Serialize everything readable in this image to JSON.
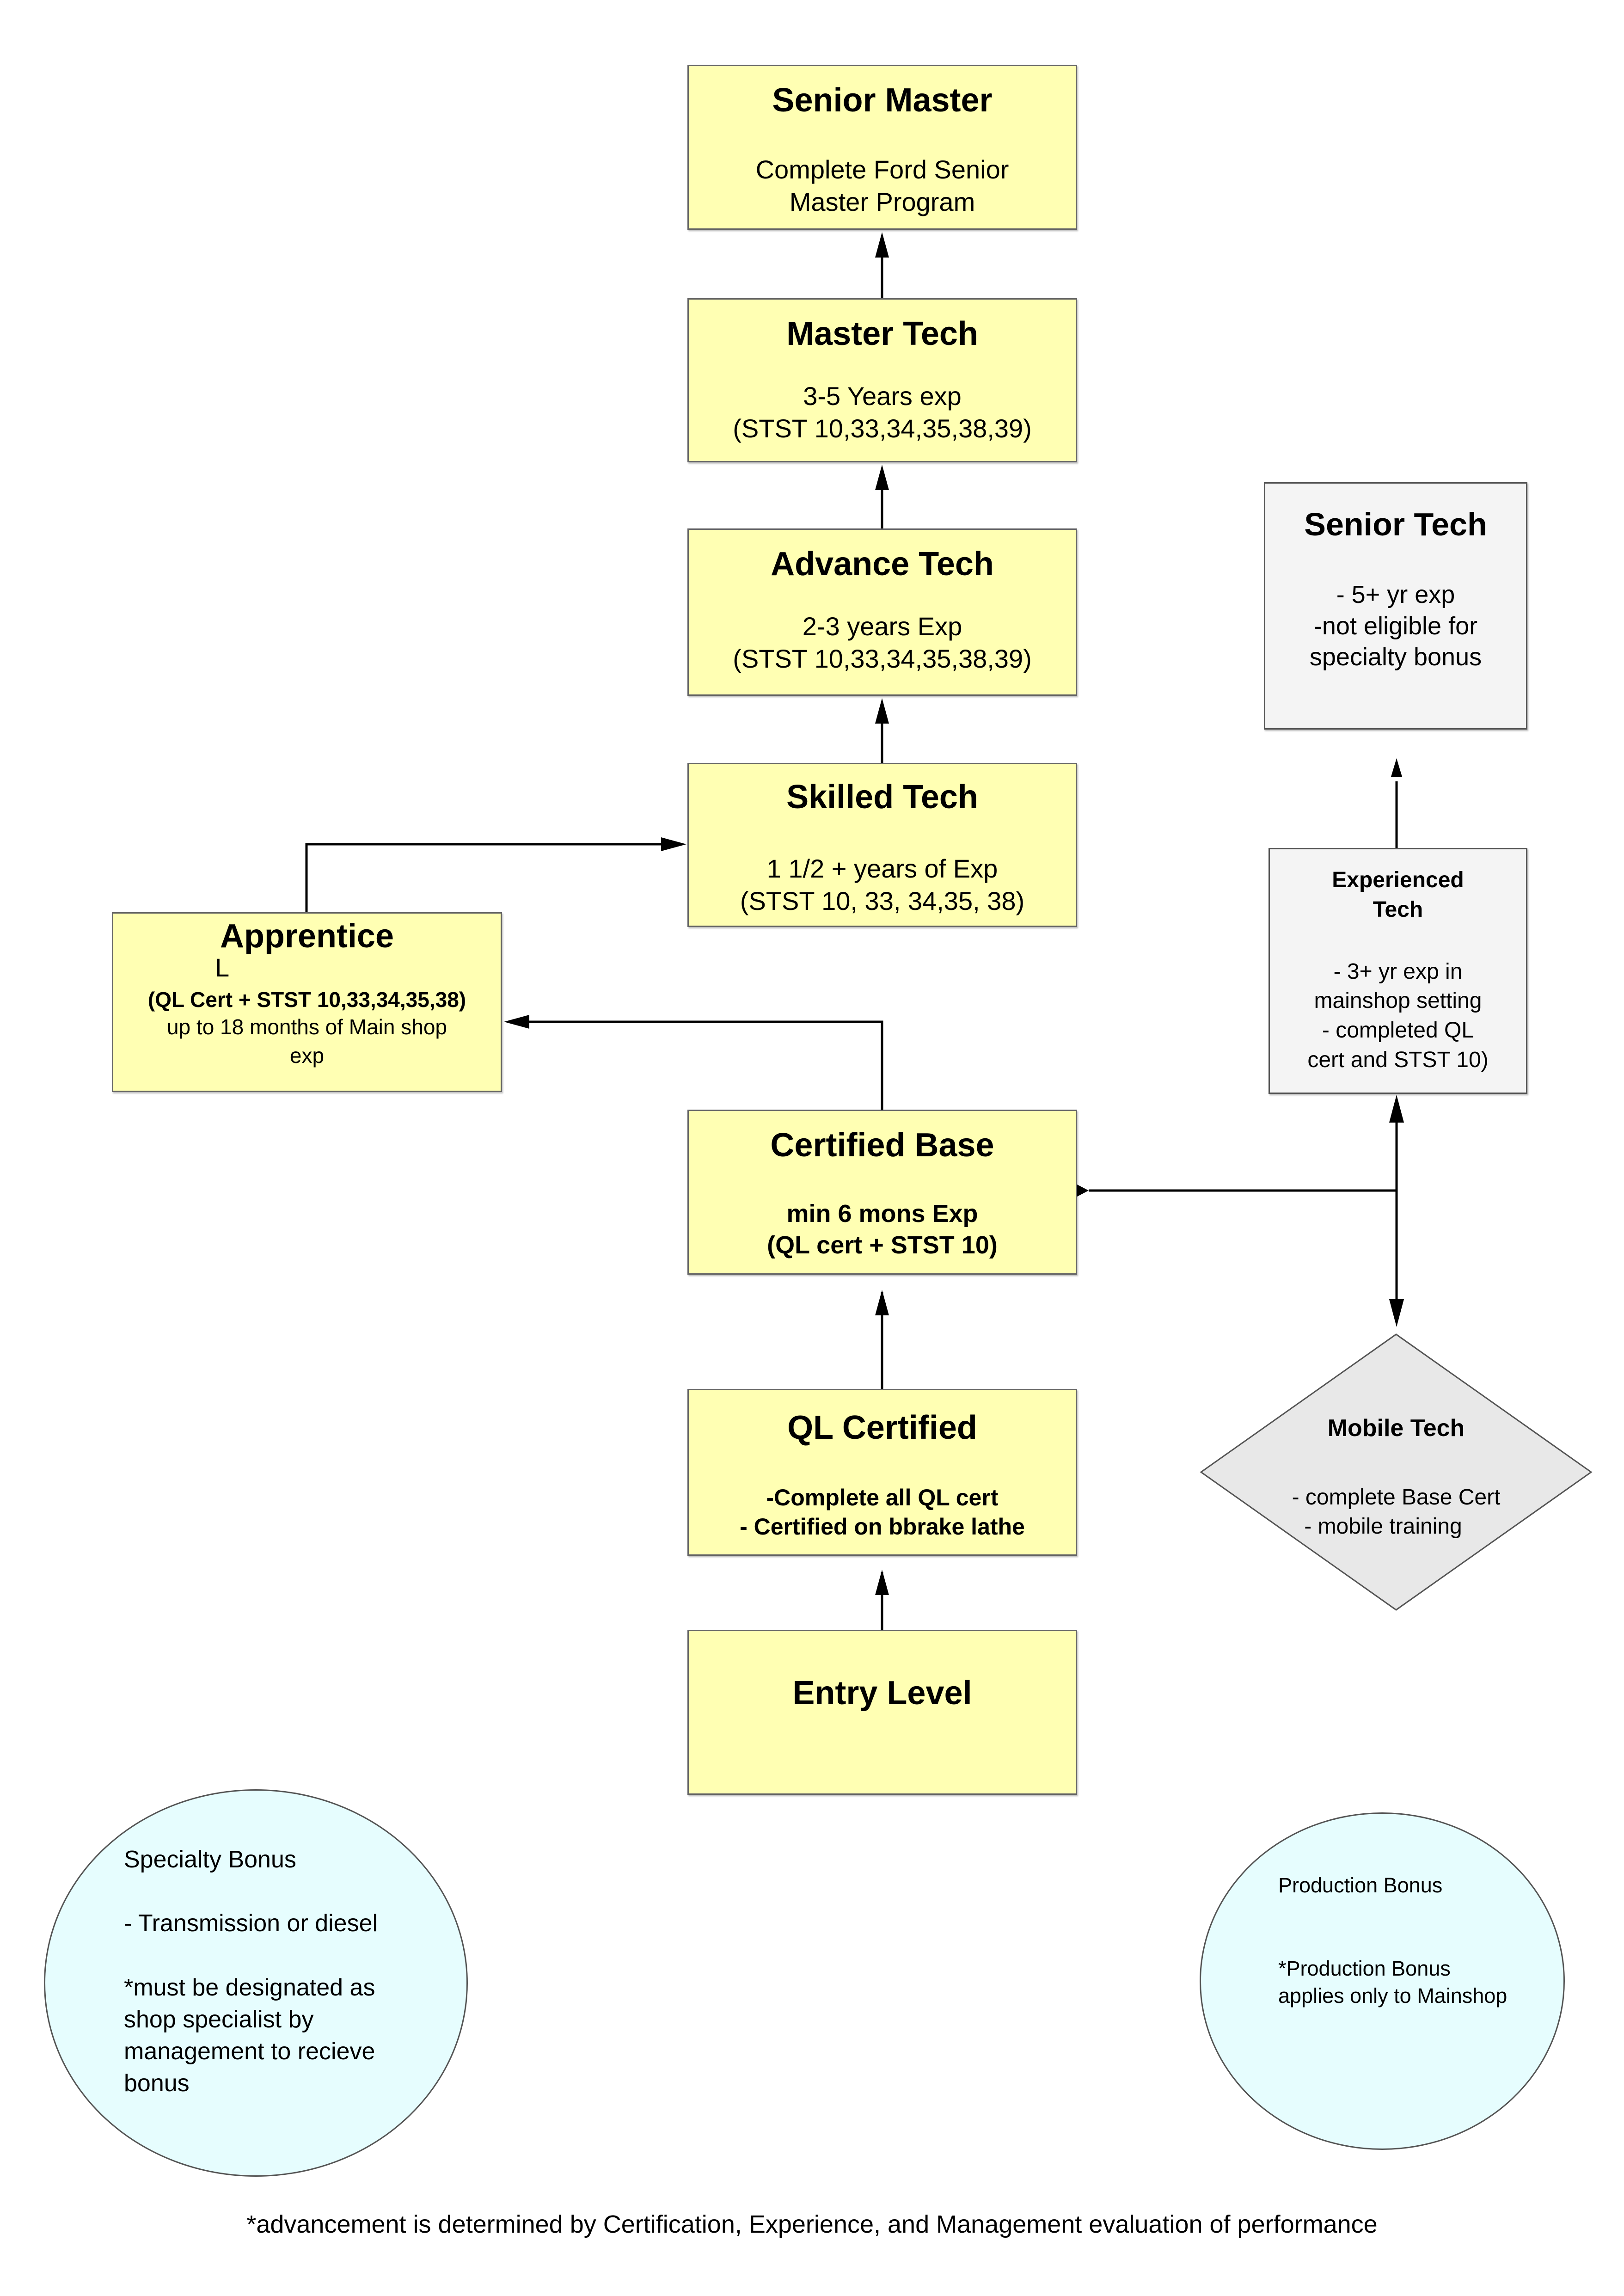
{
  "nodes": {
    "senior_master": {
      "title": "Senior Master",
      "description": "Complete Ford Senior\nMaster Program"
    },
    "master_tech": {
      "title": "Master Tech",
      "description": "3-5 Years exp\n(STST 10,33,34,35,38,39)"
    },
    "advance_tech": {
      "title": "Advance Tech",
      "description": "2-3 years Exp\n(STST 10,33,34,35,38,39)"
    },
    "skilled_tech": {
      "title": "Skilled Tech",
      "description": "1 1/2 + years of Exp\n(STST 10, 33, 34,35, 38)"
    },
    "apprentice": {
      "title": "Apprentice",
      "stray_char": "L",
      "requirement": "(QL Cert + STST 10,33,34,35,38)",
      "description": "up to 18 months of Main shop\nexp"
    },
    "certified_base": {
      "title": "Certified Base",
      "description": "min  6 mons Exp\n(QL cert + STST 10)"
    },
    "ql_certified": {
      "title": "QL Certified",
      "description": "-Complete all QL cert\n- Certified on bbrake lathe"
    },
    "entry_level": {
      "title": "Entry Level"
    },
    "senior_tech": {
      "title": "Senior Tech",
      "description": "- 5+ yr exp\n-not eligible for\nspecialty bonus"
    },
    "experienced_tech": {
      "title": "Experienced\nTech",
      "description": "-   3+ yr exp in\nmainshop setting\n- completed QL\ncert and STST 10)"
    },
    "mobile_tech": {
      "title": "Mobile Tech",
      "description": "- complete Base Cert\n  - mobile training"
    }
  },
  "bonuses": {
    "specialty": {
      "text": "Specialty Bonus\n\n- Transmission or diesel\n\n*must be designated as\nshop specialist by\nmanagement to recieve\nbonus"
    },
    "production": {
      "text": "Production Bonus\n\n\n*Production Bonus\napplies only to Mainshop"
    }
  },
  "edges": [
    {
      "from": "entry_level",
      "to": "ql_certified"
    },
    {
      "from": "ql_certified",
      "to": "certified_base"
    },
    {
      "from": "certified_base",
      "to": "apprentice"
    },
    {
      "from": "certified_base",
      "to": "experienced_tech"
    },
    {
      "from": "certified_base",
      "to": "mobile_tech"
    },
    {
      "from": "apprentice",
      "to": "skilled_tech"
    },
    {
      "from": "skilled_tech",
      "to": "advance_tech"
    },
    {
      "from": "advance_tech",
      "to": "master_tech"
    },
    {
      "from": "master_tech",
      "to": "senior_master"
    },
    {
      "from": "experienced_tech",
      "to": "senior_tech"
    }
  ],
  "colors": {
    "career_node": "#ffffb3",
    "side_node": "#f4f4f4",
    "mobile_node": "#e8e8e8",
    "bonus_circle": "#e6fdfe"
  },
  "footer": "*advancement is determined by Certification, Experience, and Management evaluation of performance"
}
